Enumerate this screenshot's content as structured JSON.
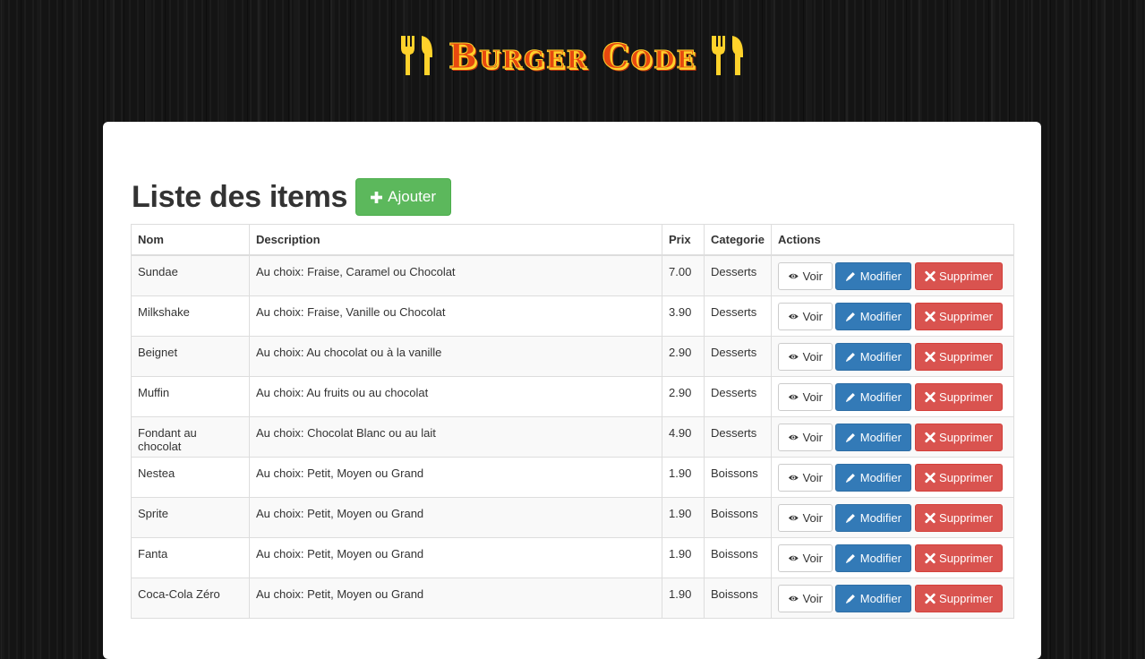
{
  "brand": {
    "title": "Burger Code",
    "accent": "#e7480f",
    "outline": "#ffd22b"
  },
  "page": {
    "title": "Liste des items",
    "add_label": "Ajouter"
  },
  "table": {
    "headers": {
      "name": "Nom",
      "description": "Description",
      "price": "Prix",
      "category": "Categorie",
      "actions": "Actions"
    },
    "rows": [
      {
        "name": "Sundae",
        "description": "Au choix: Fraise, Caramel ou Chocolat",
        "price": "7.00",
        "category": "Desserts"
      },
      {
        "name": "Milkshake",
        "description": "Au choix: Fraise, Vanille ou Chocolat",
        "price": "3.90",
        "category": "Desserts"
      },
      {
        "name": "Beignet",
        "description": "Au choix: Au chocolat ou à la vanille",
        "price": "2.90",
        "category": "Desserts"
      },
      {
        "name": "Muffin",
        "description": "Au choix: Au fruits ou au chocolat",
        "price": "2.90",
        "category": "Desserts"
      },
      {
        "name": "Fondant au chocolat",
        "description": "Au choix: Chocolat Blanc ou au lait",
        "price": "4.90",
        "category": "Desserts"
      },
      {
        "name": "Nestea",
        "description": "Au choix: Petit, Moyen ou Grand",
        "price": "1.90",
        "category": "Boissons"
      },
      {
        "name": "Sprite",
        "description": "Au choix: Petit, Moyen ou Grand",
        "price": "1.90",
        "category": "Boissons"
      },
      {
        "name": "Fanta",
        "description": "Au choix: Petit, Moyen ou Grand",
        "price": "1.90",
        "category": "Boissons"
      },
      {
        "name": "Coca-Cola Zéro",
        "description": "Au choix: Petit, Moyen ou Grand",
        "price": "1.90",
        "category": "Boissons"
      }
    ]
  },
  "actions": {
    "view_label": "Voir",
    "edit_label": "Modifier",
    "delete_label": "Supprimer"
  },
  "icons": {
    "add": "plus-icon",
    "view": "eye-icon",
    "edit": "pencil-icon",
    "delete": "x-icon",
    "logo": "cutlery-icon"
  },
  "colors": {
    "success": "#5cb85c",
    "primary": "#337ab7",
    "danger": "#d9534f"
  }
}
